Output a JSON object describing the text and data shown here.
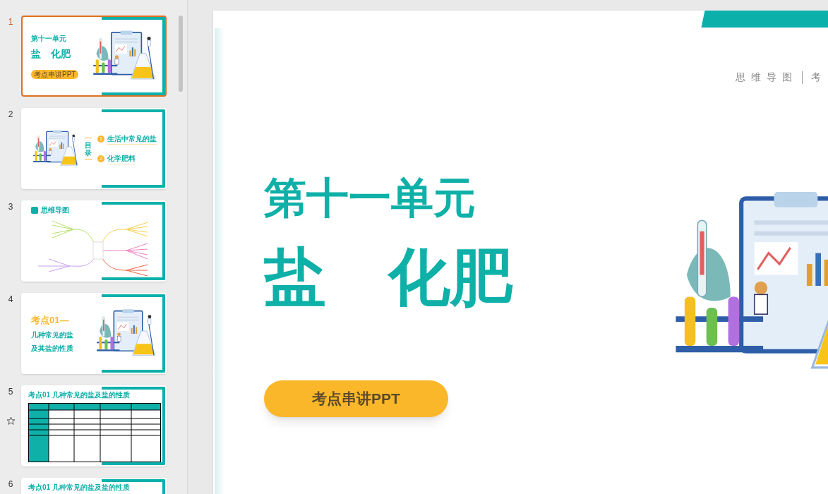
{
  "thumbnails": [
    {
      "number": "1",
      "selected": true,
      "starred": false,
      "kind": "cover",
      "title": "第十一单元",
      "subtitle": "盐　化肥",
      "button": "考点串讲PPT"
    },
    {
      "number": "2",
      "selected": false,
      "starred": false,
      "kind": "contents",
      "heading": "目录",
      "items": [
        {
          "marker": "1",
          "label": "生活中常见的盐"
        },
        {
          "marker": "2",
          "label": "化学肥料"
        }
      ]
    },
    {
      "number": "3",
      "selected": false,
      "starred": false,
      "kind": "mindmap",
      "heading": "思维导图"
    },
    {
      "number": "4",
      "selected": false,
      "starred": false,
      "kind": "section",
      "label": "考点01—",
      "lines": [
        "几种常见的盐",
        "及其盐的性质"
      ]
    },
    {
      "number": "5",
      "selected": false,
      "starred": true,
      "kind": "table",
      "heading": "考点01 几种常见的盐及盐的性质"
    },
    {
      "number": "6",
      "selected": false,
      "starred": false,
      "kind": "table",
      "heading": "考点01 几种常见的盐及盐的性质"
    }
  ],
  "slide": {
    "nav": [
      "思 维 导 图",
      "考"
    ],
    "title": "第十一单元",
    "subtitle": "盐　化肥",
    "button": "考点串讲PPT"
  }
}
